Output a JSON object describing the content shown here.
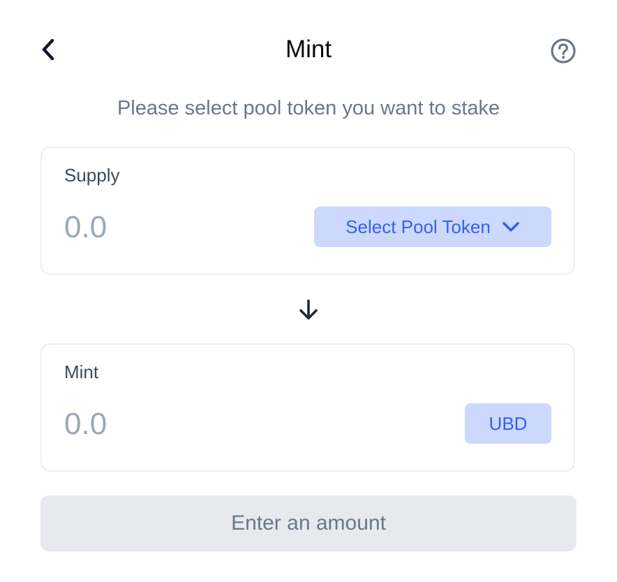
{
  "header": {
    "title": "Mint",
    "back_icon": "chevron-left-icon",
    "help_icon": "question-circle-icon"
  },
  "subtitle": "Please select pool token you want to stake",
  "supply": {
    "label": "Supply",
    "placeholder": "0.0",
    "token_button_label": "Select Pool Token",
    "token_button_icon": "chevron-down-icon"
  },
  "direction_icon": "arrow-down-icon",
  "mint": {
    "label": "Mint",
    "placeholder": "0.0",
    "token_label": "UBD"
  },
  "submit": {
    "label": "Enter an amount"
  },
  "colors": {
    "accent": "#3560f2",
    "accent_bg": "#ccd9fc",
    "muted_text": "#6b7789",
    "placeholder": "#9aa8ba",
    "disabled_bg": "#e7e9ed",
    "border": "#eceef1"
  }
}
